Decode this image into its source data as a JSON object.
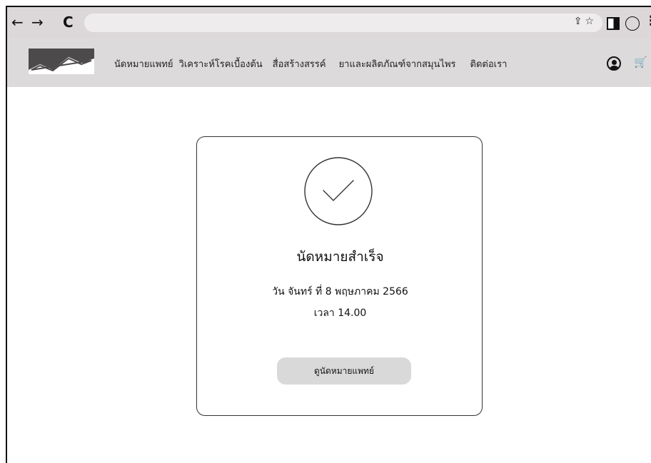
{
  "browser": {
    "back": "←",
    "forward": "→",
    "reload": "C",
    "address_icons": "⇪☆",
    "more": "⋮"
  },
  "header": {
    "menu": [
      {
        "label": "นัดหมายแพทย์"
      },
      {
        "label": "วิเคราะห์โรคเบื้องต้น"
      },
      {
        "label": "สื่อสร้างสรรค์"
      },
      {
        "label": "ยาและผลิตภัณฑ์จากสมุนไพร"
      },
      {
        "label": "ติดต่อเรา"
      }
    ],
    "cart_glyph": "🛒"
  },
  "confirmation": {
    "title": "นัดหมายสำเร็จ",
    "date": "วัน จันทร์ ที่ 8 พฤษภาคม 2566",
    "time": "เวลา 14.00",
    "button_label": "ดูนัดหมายแพทย์"
  }
}
